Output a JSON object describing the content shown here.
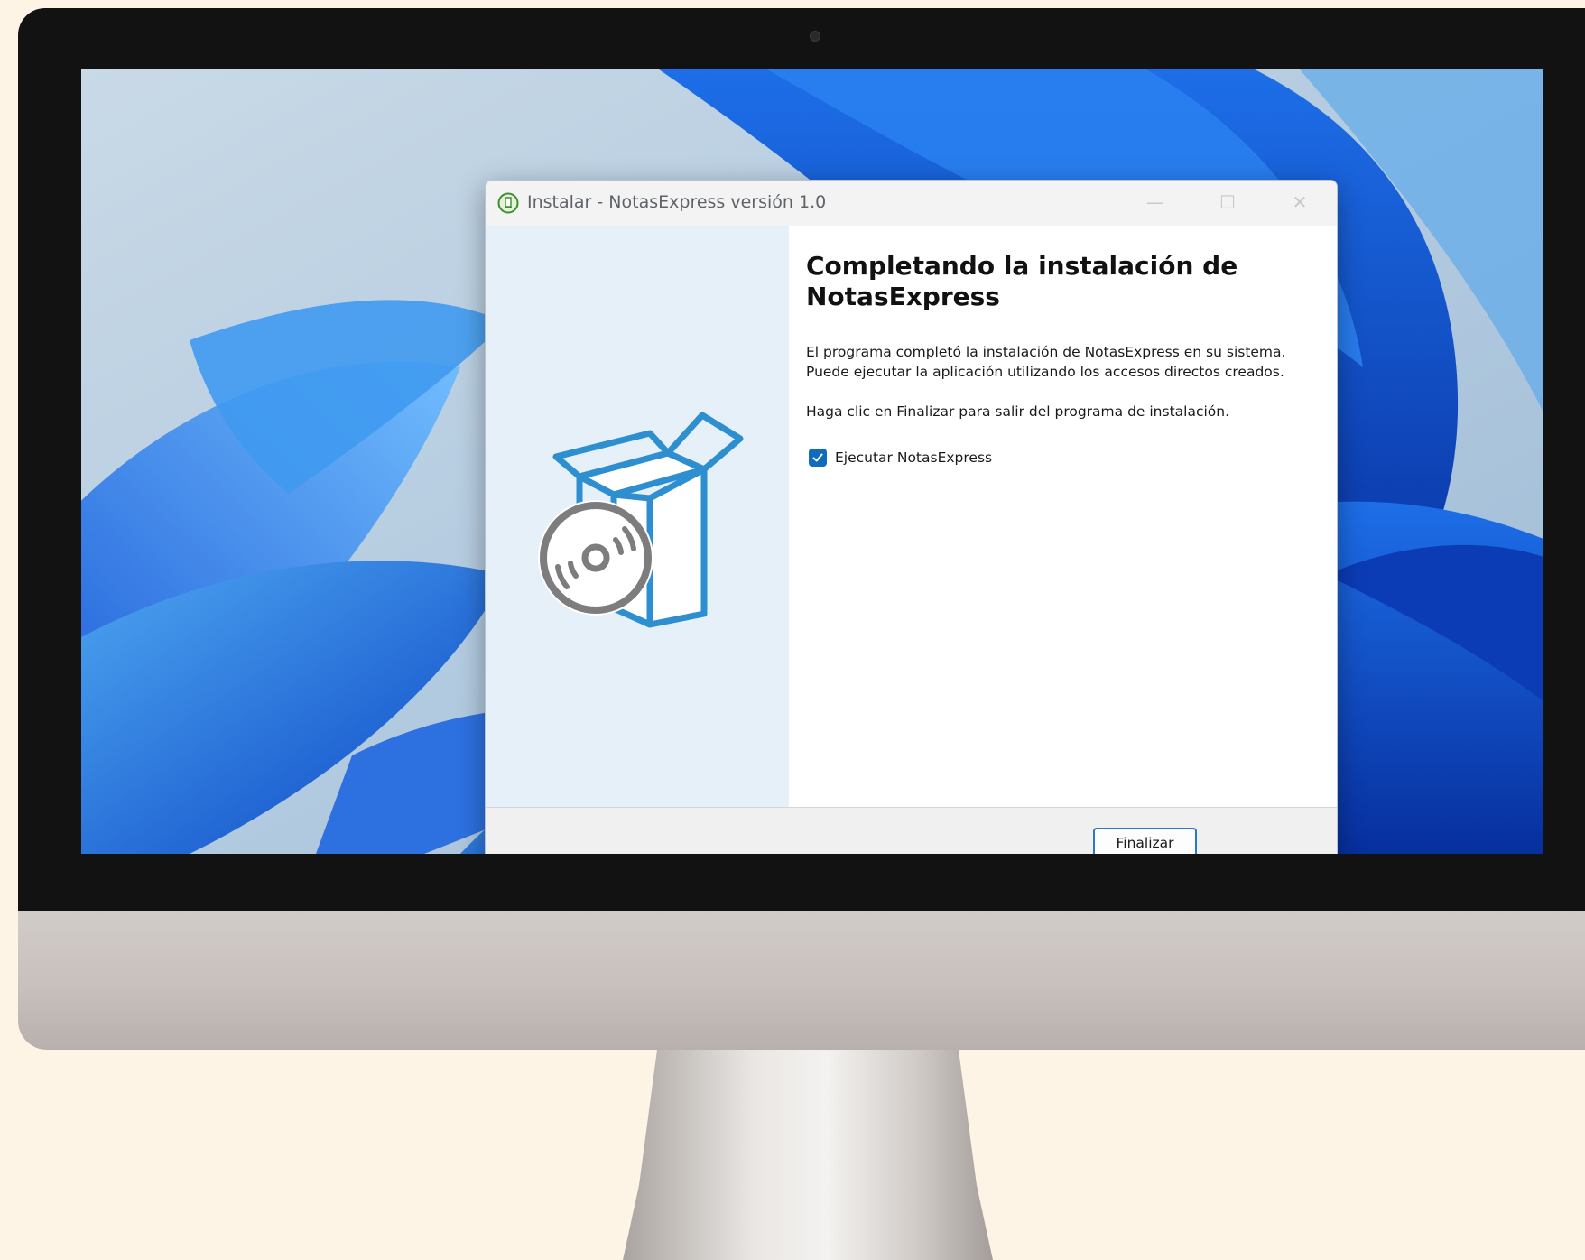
{
  "window": {
    "title": "Instalar - NotasExpress versión 1.0",
    "controls": {
      "minimize": "—",
      "maximize": "☐",
      "close": "✕"
    }
  },
  "content": {
    "heading": "Completando la instalación de NotasExpress",
    "paragraph1": "El programa completó la instalación de NotasExpress en su sistema. Puede ejecutar la aplicación utilizando los accesos directos creados.",
    "paragraph2": "Haga clic en Finalizar para salir del programa de instalación.",
    "checkbox": {
      "label": "Ejecutar NotasExpress",
      "checked": true
    }
  },
  "footer": {
    "finish_label": "Finalizar"
  },
  "icons": {
    "app": "installer-app-icon",
    "illustration": "software-box-cd-icon",
    "check": "checkmark-icon"
  },
  "colors": {
    "accent": "#0f6cbd",
    "side_panel": "#e6f0f8",
    "illustration_blue": "#2e8fd0",
    "disc_gray": "#7d7d7d"
  }
}
